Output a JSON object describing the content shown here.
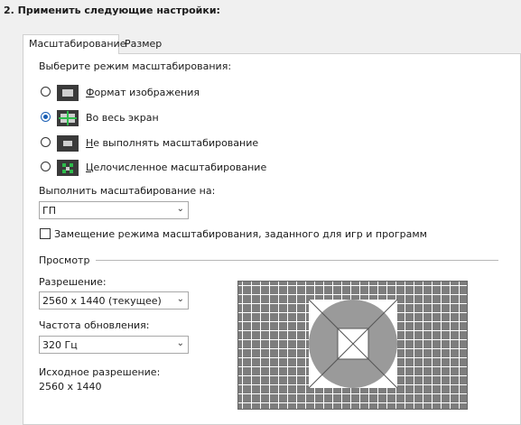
{
  "step_title": "2. Применить следующие настройки:",
  "tabs": [
    {
      "label": "Масштабирование",
      "active": true
    },
    {
      "label": "Размер",
      "active": false
    }
  ],
  "scaling_mode": {
    "prompt": "Выберите режим масштабирования:",
    "options": [
      {
        "label": "Формат изображения",
        "underline_char": "Ф",
        "rest": "ормат изображения",
        "checked": false,
        "icon": "aspect-ratio-icon"
      },
      {
        "label": "Во весь экран",
        "underline_char": "",
        "rest": "Во весь экран",
        "checked": true,
        "icon": "fullscreen-icon"
      },
      {
        "label": "Не выполнять масштабирование",
        "underline_char": "Н",
        "rest": "е выполнять масштабирование",
        "checked": false,
        "icon": "no-scaling-icon"
      },
      {
        "label": "Целочисленное масштабирование",
        "underline_char": "Ц",
        "rest": "елочисленное масштабирование",
        "checked": false,
        "icon": "integer-scaling-icon"
      }
    ]
  },
  "perform_on": {
    "label": "Выполнить масштабирование на:",
    "value": "ГП"
  },
  "override": {
    "label": "Замещение режима масштабирования, заданного для игр и программ",
    "checked": false
  },
  "preview": {
    "section_label": "Просмотр",
    "resolution_label": "Разрешение:",
    "resolution_value": "2560 x 1440 (текущее)",
    "refresh_label": "Частота обновления:",
    "refresh_value": "320 Гц",
    "native_label": "Исходное разрешение:",
    "native_value": "2560 x 1440"
  },
  "colors": {
    "accent": "#1a5fb4",
    "preview_grid": "#7d7d7d",
    "preview_disc": "#9a9a9a"
  }
}
